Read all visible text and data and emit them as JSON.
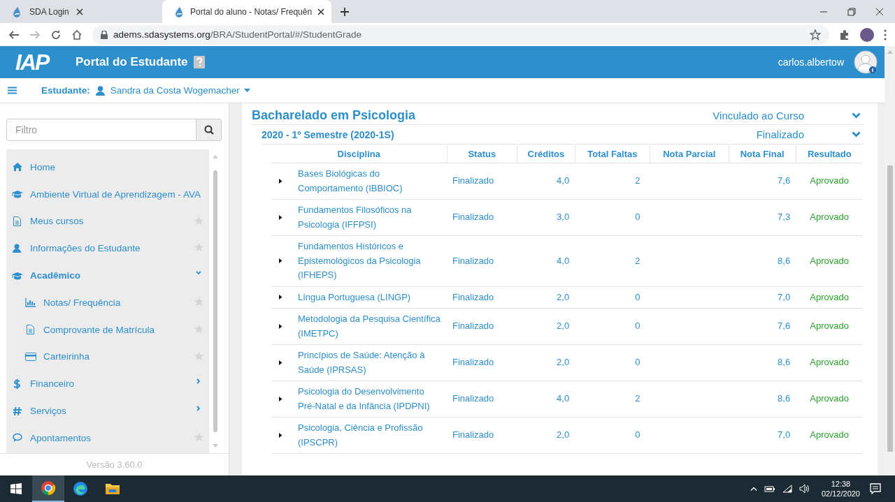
{
  "browser": {
    "tabs": [
      {
        "title": "SDA Login",
        "selected": false
      },
      {
        "title": "Portal do aluno - Notas/ Frequên",
        "selected": true
      }
    ],
    "url_host": "adems.sdasystems.org",
    "url_path": "/BRA/StudentPortal/#/StudentGrade"
  },
  "header": {
    "logo": "IAP",
    "title": "Portal do Estudante",
    "username": "carlos.albertow"
  },
  "student_bar": {
    "label": "Estudante:",
    "name": "Sandra da Costa Wogemacher"
  },
  "sidebar": {
    "filter_placeholder": "Filtro",
    "menu": [
      {
        "label": "Home",
        "kind": "link"
      },
      {
        "label": "Ambiente Virtual de Aprendizagem - AVA",
        "kind": "link"
      },
      {
        "label": "Meus cursos",
        "kind": "link",
        "favorite": false
      },
      {
        "label": "Informações do Estudante",
        "kind": "link",
        "favorite": false
      },
      {
        "label": "Acadêmico",
        "kind": "group",
        "expanded": true,
        "children": [
          {
            "label": "Notas/ Frequência",
            "favorite": false
          },
          {
            "label": "Comprovante de Matrícula",
            "favorite": false
          },
          {
            "label": "Carteirinha",
            "favorite": false
          }
        ]
      },
      {
        "label": "Financeiro",
        "kind": "group",
        "expanded": false
      },
      {
        "label": "Serviços",
        "kind": "group",
        "expanded": false
      },
      {
        "label": "Apontamentos",
        "kind": "link",
        "favorite": false
      }
    ],
    "version": "Versão 3.60.0"
  },
  "course": {
    "title": "Bacharelado em Psicologia",
    "status": "Vinculado ao Curso",
    "expanded": true,
    "semester": {
      "title": "2020 - 1º Semestre (2020-1S)",
      "status": "Finalizado",
      "expanded": true,
      "columns": [
        "Disciplina",
        "Status",
        "Créditos",
        "Total Faltas",
        "Nota Parcial",
        "Nota Final",
        "Resultado"
      ],
      "rows": [
        {
          "disciplina": "Bases Biológicas do Comportamento (IBBIOC)",
          "status": "Finalizado",
          "creditos": "4,0",
          "total_faltas": "2",
          "nota_final": "7,6",
          "resultado": "Aprovado",
          "expanded": false
        },
        {
          "disciplina": "Fundamentos Filosóficos na Psicologia (IFFPSI)",
          "status": "Finalizado",
          "creditos": "3,0",
          "total_faltas": "0",
          "nota_final": "7,3",
          "resultado": "Aprovado",
          "expanded": false
        },
        {
          "disciplina": "Fundamentos Históricos e Epistemológicos da Psicologia (IFHEPS)",
          "status": "Finalizado",
          "creditos": "4,0",
          "total_faltas": "2",
          "nota_final": "8,6",
          "resultado": "Aprovado",
          "expanded": false
        },
        {
          "disciplina": "Língua Portuguesa (LINGP)",
          "status": "Finalizado",
          "creditos": "2,0",
          "total_faltas": "0",
          "nota_final": "7,0",
          "resultado": "Aprovado",
          "expanded": false
        },
        {
          "disciplina": "Metodologia da Pesquisa Científica (IMETPC)",
          "status": "Finalizado",
          "creditos": "2,0",
          "total_faltas": "0",
          "nota_final": "7,6",
          "resultado": "Aprovado",
          "expanded": false
        },
        {
          "disciplina": "Princípios de Saúde: Atenção à Saúde (IPRSAS)",
          "status": "Finalizado",
          "creditos": "2,0",
          "total_faltas": "0",
          "nota_final": "8,6",
          "resultado": "Aprovado",
          "expanded": false
        },
        {
          "disciplina": "Psicologia do Desenvolvimento Pré-Natal e da Infância (IPDPNI)",
          "status": "Finalizado",
          "creditos": "4,0",
          "total_faltas": "2",
          "nota_final": "8,6",
          "resultado": "Aprovado",
          "expanded": false
        },
        {
          "disciplina": "Psicologia, Ciência e Profissão (IPSCPR)",
          "status": "Finalizado",
          "creditos": "2,0",
          "total_faltas": "0",
          "nota_final": "7,0",
          "resultado": "Aprovado",
          "expanded": false
        }
      ]
    }
  },
  "taskbar": {
    "apps": [
      {
        "kind": "chrome",
        "selected": true
      },
      {
        "kind": "edge",
        "selected": false
      },
      {
        "kind": "folder",
        "selected": false
      }
    ],
    "time": "12:38",
    "date": "02/12/2020"
  }
}
